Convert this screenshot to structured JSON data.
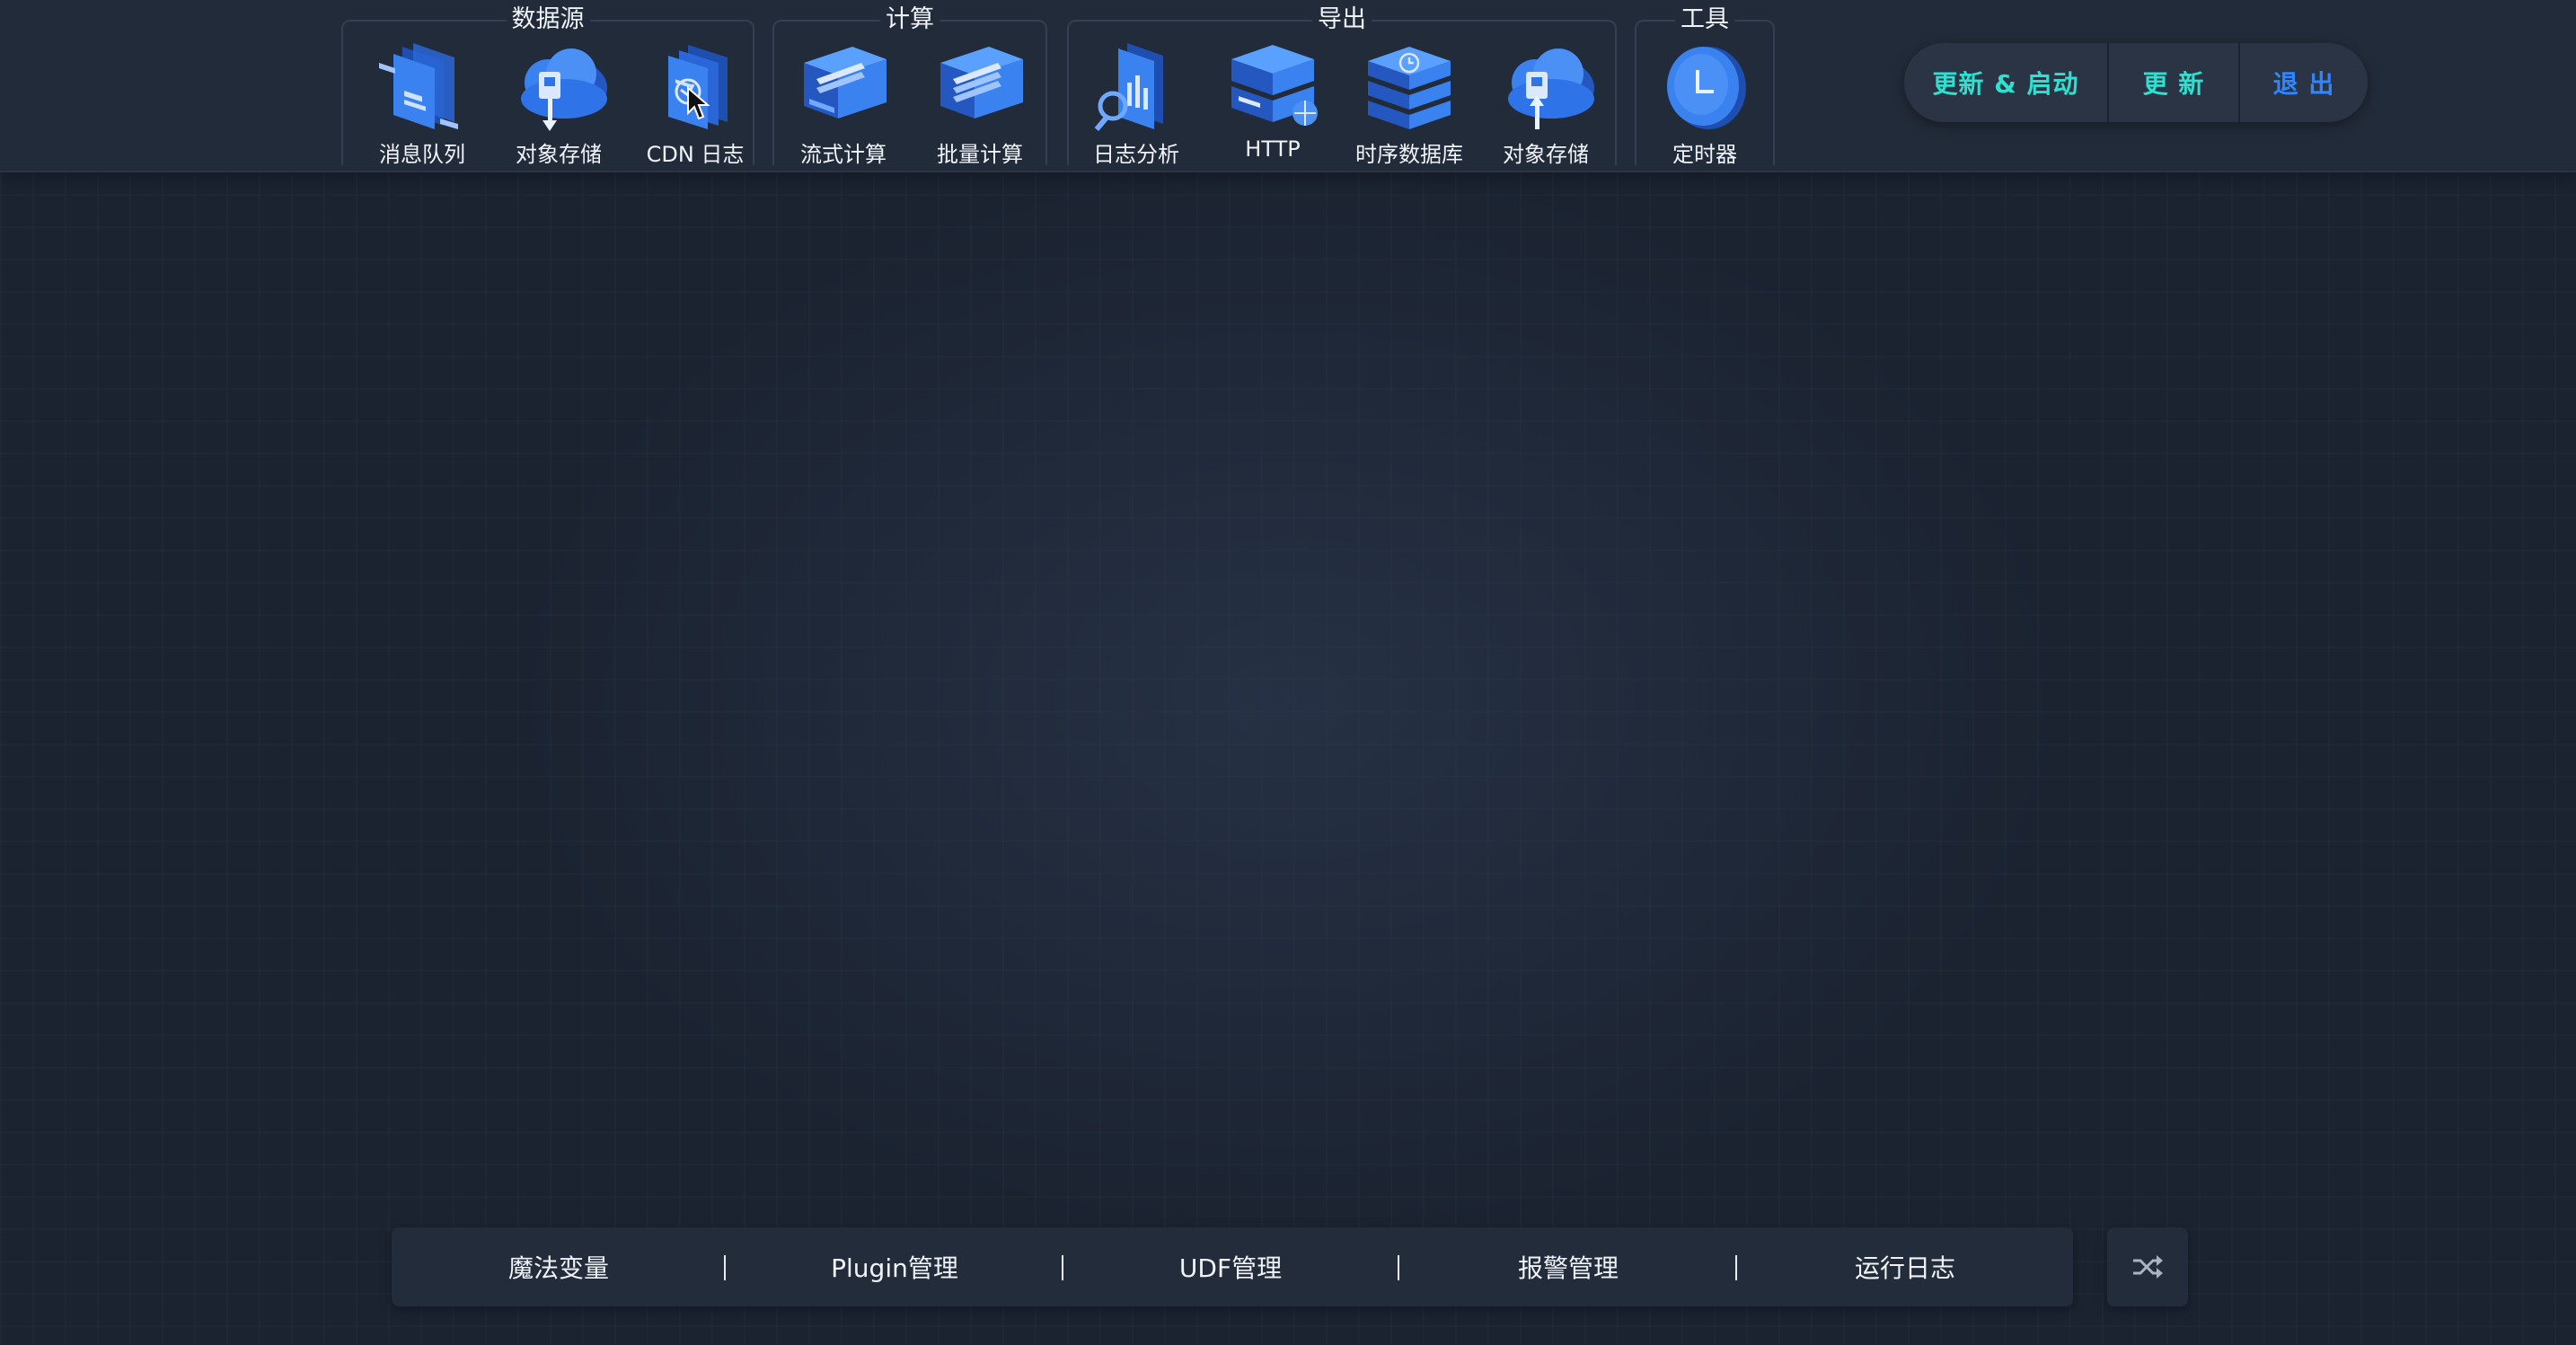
{
  "colors": {
    "accent_teal": "#2fe0d0",
    "accent_blue": "#2f86ff",
    "icon_blue": "#2f73e8"
  },
  "toolbar": {
    "groups": [
      {
        "title": "数据源",
        "items": [
          {
            "label": "消息队列",
            "icon": "message-queue-icon"
          },
          {
            "label": "对象存储",
            "icon": "object-storage-icon"
          },
          {
            "label": "CDN 日志",
            "icon": "cdn-log-icon"
          }
        ]
      },
      {
        "title": "计算",
        "items": [
          {
            "label": "流式计算",
            "icon": "stream-compute-icon"
          },
          {
            "label": "批量计算",
            "icon": "batch-compute-icon"
          }
        ]
      },
      {
        "title": "导出",
        "items": [
          {
            "label": "日志分析",
            "icon": "log-analysis-icon"
          },
          {
            "label": "HTTP",
            "icon": "http-icon"
          },
          {
            "label": "时序数据库",
            "icon": "timeseries-db-icon"
          },
          {
            "label": "对象存储",
            "icon": "object-storage-icon"
          }
        ]
      },
      {
        "title": "工具",
        "items": [
          {
            "label": "定时器",
            "icon": "timer-icon"
          }
        ]
      }
    ]
  },
  "actions": {
    "update_start": "更新 & 启动",
    "update": "更 新",
    "exit": "退 出"
  },
  "bottom_bar": {
    "items": [
      "魔法变量",
      "Plugin管理",
      "UDF管理",
      "报警管理",
      "运行日志"
    ],
    "shuffle_icon": "shuffle-icon"
  }
}
